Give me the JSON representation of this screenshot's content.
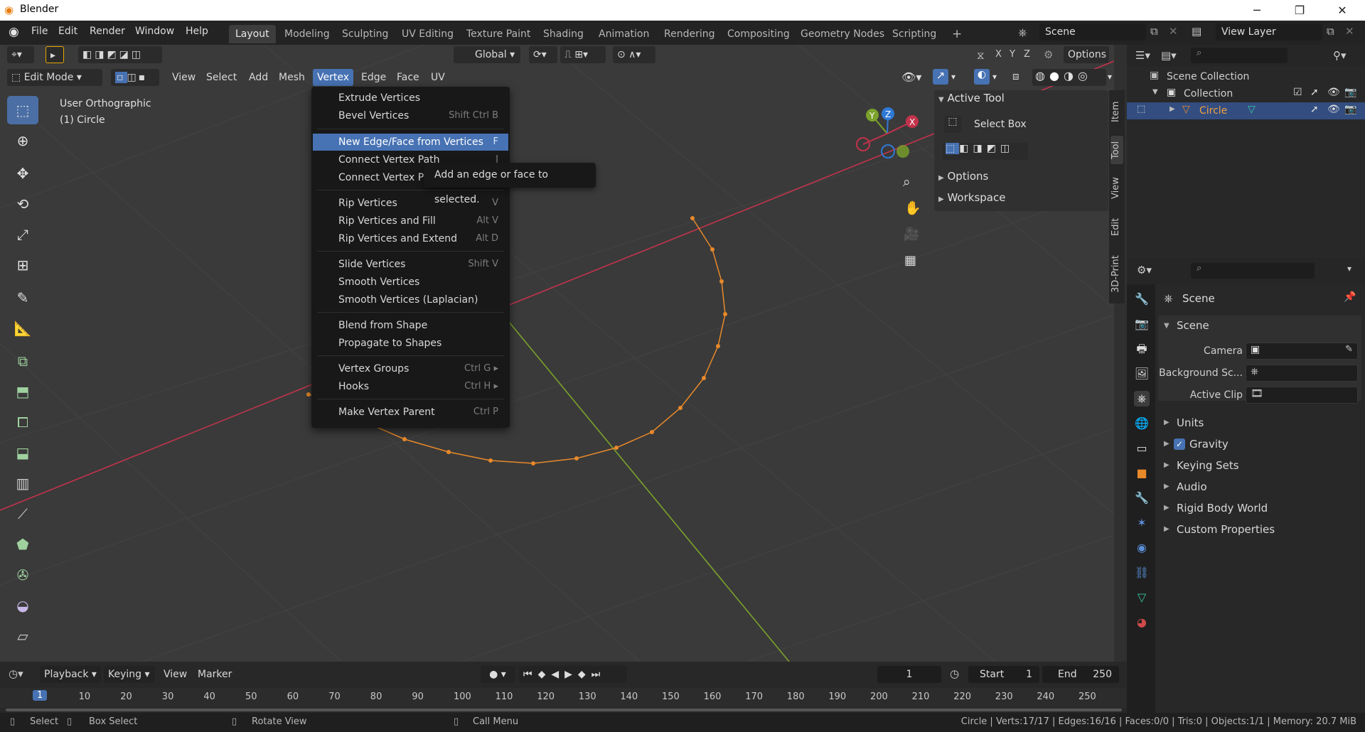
{
  "titlebar": {
    "title": "Blender",
    "min": "─",
    "max": "❐",
    "close": "✕"
  },
  "menubar": {
    "items": [
      "File",
      "Edit",
      "Render",
      "Window",
      "Help"
    ],
    "workspaces": [
      "Layout",
      "Modeling",
      "Sculpting",
      "UV Editing",
      "Texture Paint",
      "Shading",
      "Animation",
      "Rendering",
      "Compositing",
      "Geometry Nodes",
      "Scripting"
    ],
    "add_tab": "+",
    "scene": "Scene",
    "view_layer": "View Layer"
  },
  "viewport_header": {
    "transform_orientation": "Global",
    "options": "Options",
    "axes": [
      "X",
      "Y",
      "Z"
    ],
    "mode": "Edit Mode",
    "menus": [
      "View",
      "Select",
      "Add",
      "Mesh",
      "Vertex",
      "Edge",
      "Face",
      "UV"
    ],
    "active_menu": "Vertex"
  },
  "viewport": {
    "view_name": "User Orthographic",
    "object_label": "(1) Circle"
  },
  "vertex_menu": {
    "items": [
      {
        "label": "Extrude Vertices",
        "shortcut": ""
      },
      {
        "label": "Bevel Vertices",
        "shortcut": "Shift Ctrl B"
      },
      {
        "label": "New Edge/Face from Vertices",
        "shortcut": "F"
      },
      {
        "label": "Connect Vertex Path",
        "shortcut": "J"
      },
      {
        "label": "Connect Vertex Pa",
        "shortcut": ""
      },
      {
        "label": "Rip Vertices",
        "shortcut": "V"
      },
      {
        "label": "Rip Vertices and Fill",
        "shortcut": "Alt V"
      },
      {
        "label": "Rip Vertices and Extend",
        "shortcut": "Alt D"
      },
      {
        "label": "Slide Vertices",
        "shortcut": "Shift V"
      },
      {
        "label": "Smooth Vertices",
        "shortcut": ""
      },
      {
        "label": "Smooth Vertices (Laplacian)",
        "shortcut": ""
      },
      {
        "label": "Blend from Shape",
        "shortcut": ""
      },
      {
        "label": "Propagate to Shapes",
        "shortcut": ""
      },
      {
        "label": "Vertex Groups",
        "shortcut": "Ctrl G ▸"
      },
      {
        "label": "Hooks",
        "shortcut": "Ctrl H ▸"
      },
      {
        "label": "Make Vertex Parent",
        "shortcut": "Ctrl P"
      }
    ],
    "tooltip": "Add an edge or face to selected."
  },
  "npanel": {
    "active_tool_header": "Active Tool",
    "select_box": "Select Box",
    "options_header": "Options",
    "workspace_header": "Workspace",
    "tabs": [
      "Item",
      "Tool",
      "View",
      "Edit",
      "3D-Print"
    ]
  },
  "outliner": {
    "scene_collection": "Scene Collection",
    "collection": "Collection",
    "object": "Circle"
  },
  "properties": {
    "context": "Scene",
    "panel_scene": "Scene",
    "camera_label": "Camera",
    "background_label": "Background Sc...",
    "active_clip_label": "Active Clip",
    "panels": [
      "Units",
      "Gravity",
      "Keying Sets",
      "Audio",
      "Rigid Body World",
      "Custom Properties"
    ]
  },
  "timeline": {
    "menus": [
      "Playback",
      "Keying",
      "View",
      "Marker"
    ],
    "current_frame": "1",
    "start_label": "Start",
    "start": "1",
    "end_label": "End",
    "end": "250",
    "ticks": [
      "1",
      "10",
      "20",
      "30",
      "40",
      "50",
      "60",
      "70",
      "80",
      "90",
      "100",
      "110",
      "120",
      "130",
      "140",
      "150",
      "160",
      "170",
      "180",
      "190",
      "200",
      "210",
      "220",
      "230",
      "240",
      "250"
    ]
  },
  "statusbar": {
    "select": "Select",
    "box_select": "Box Select",
    "rotate_view": "Rotate View",
    "call_menu": "Call Menu",
    "stats": "Circle | Verts:17/17 | Edges:16/16 | Faces:0/0 | Tris:0 | Objects:1/1 | Memory: 20.7 MiB"
  },
  "colors": {
    "accent": "#4772b3",
    "edge_orange": "#e8892a",
    "x_axis": "#c2334c",
    "y_axis": "#7ba22b"
  }
}
